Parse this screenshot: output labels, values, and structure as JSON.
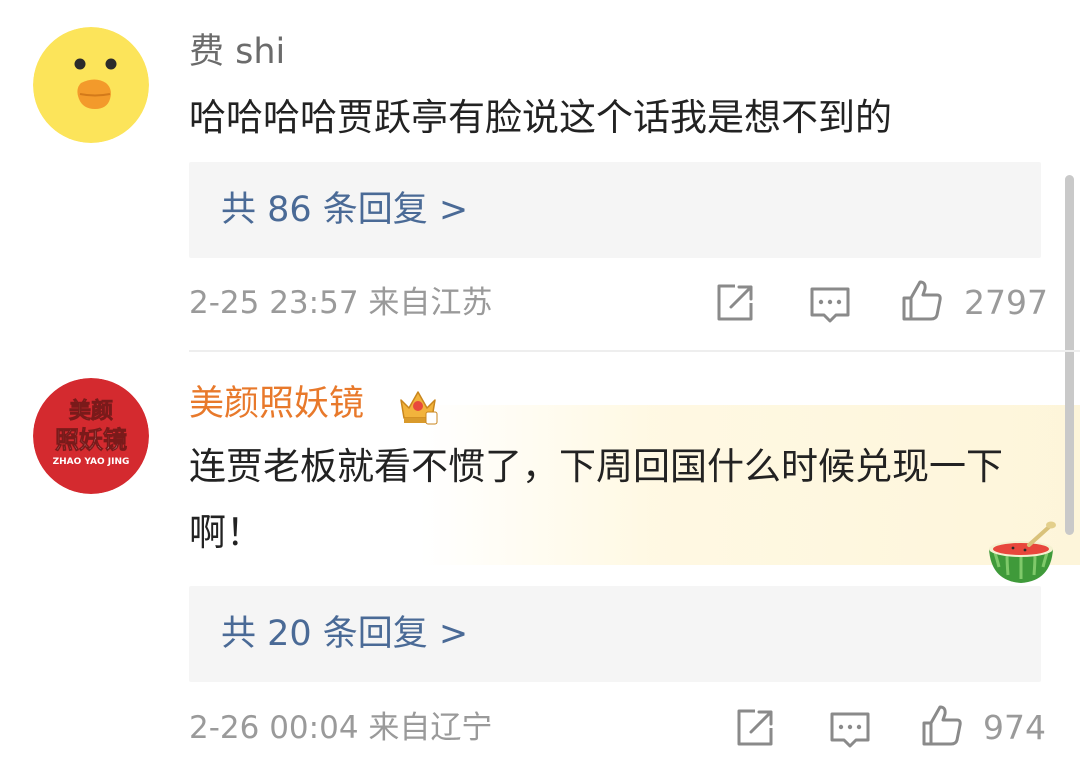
{
  "comments": [
    {
      "username": "费 shi",
      "text": "哈哈哈哈贾跃亭有脸说这个话我是想不到的",
      "replies_label": "共 86 条回复 >",
      "time": "2-25 23:57",
      "location": "来自江苏",
      "likes": "2797",
      "avatar_icon": "duck-avatar-icon"
    },
    {
      "username": "美颜照妖镜",
      "text": "连贾老板就看不惯了，下周回国什么时候兑现一下啊！",
      "replies_label": "共 20 条回复 >",
      "time": "2-26 00:04",
      "location": "来自辽宁",
      "likes": "974",
      "avatar_logo_text": [
        "美颜",
        "照妖镜",
        "ZHAO YAO JING"
      ],
      "badge_icon": "crown-icon"
    }
  ],
  "icons": {
    "share": "share-icon",
    "comment": "comment-icon",
    "like": "thumbs-up-icon",
    "decoration": "watermelon-icon"
  },
  "colors": {
    "link": "#4a6a96",
    "vip_username": "#e8792b",
    "muted": "#9a9a9a",
    "reply_bg": "#f5f5f5"
  }
}
